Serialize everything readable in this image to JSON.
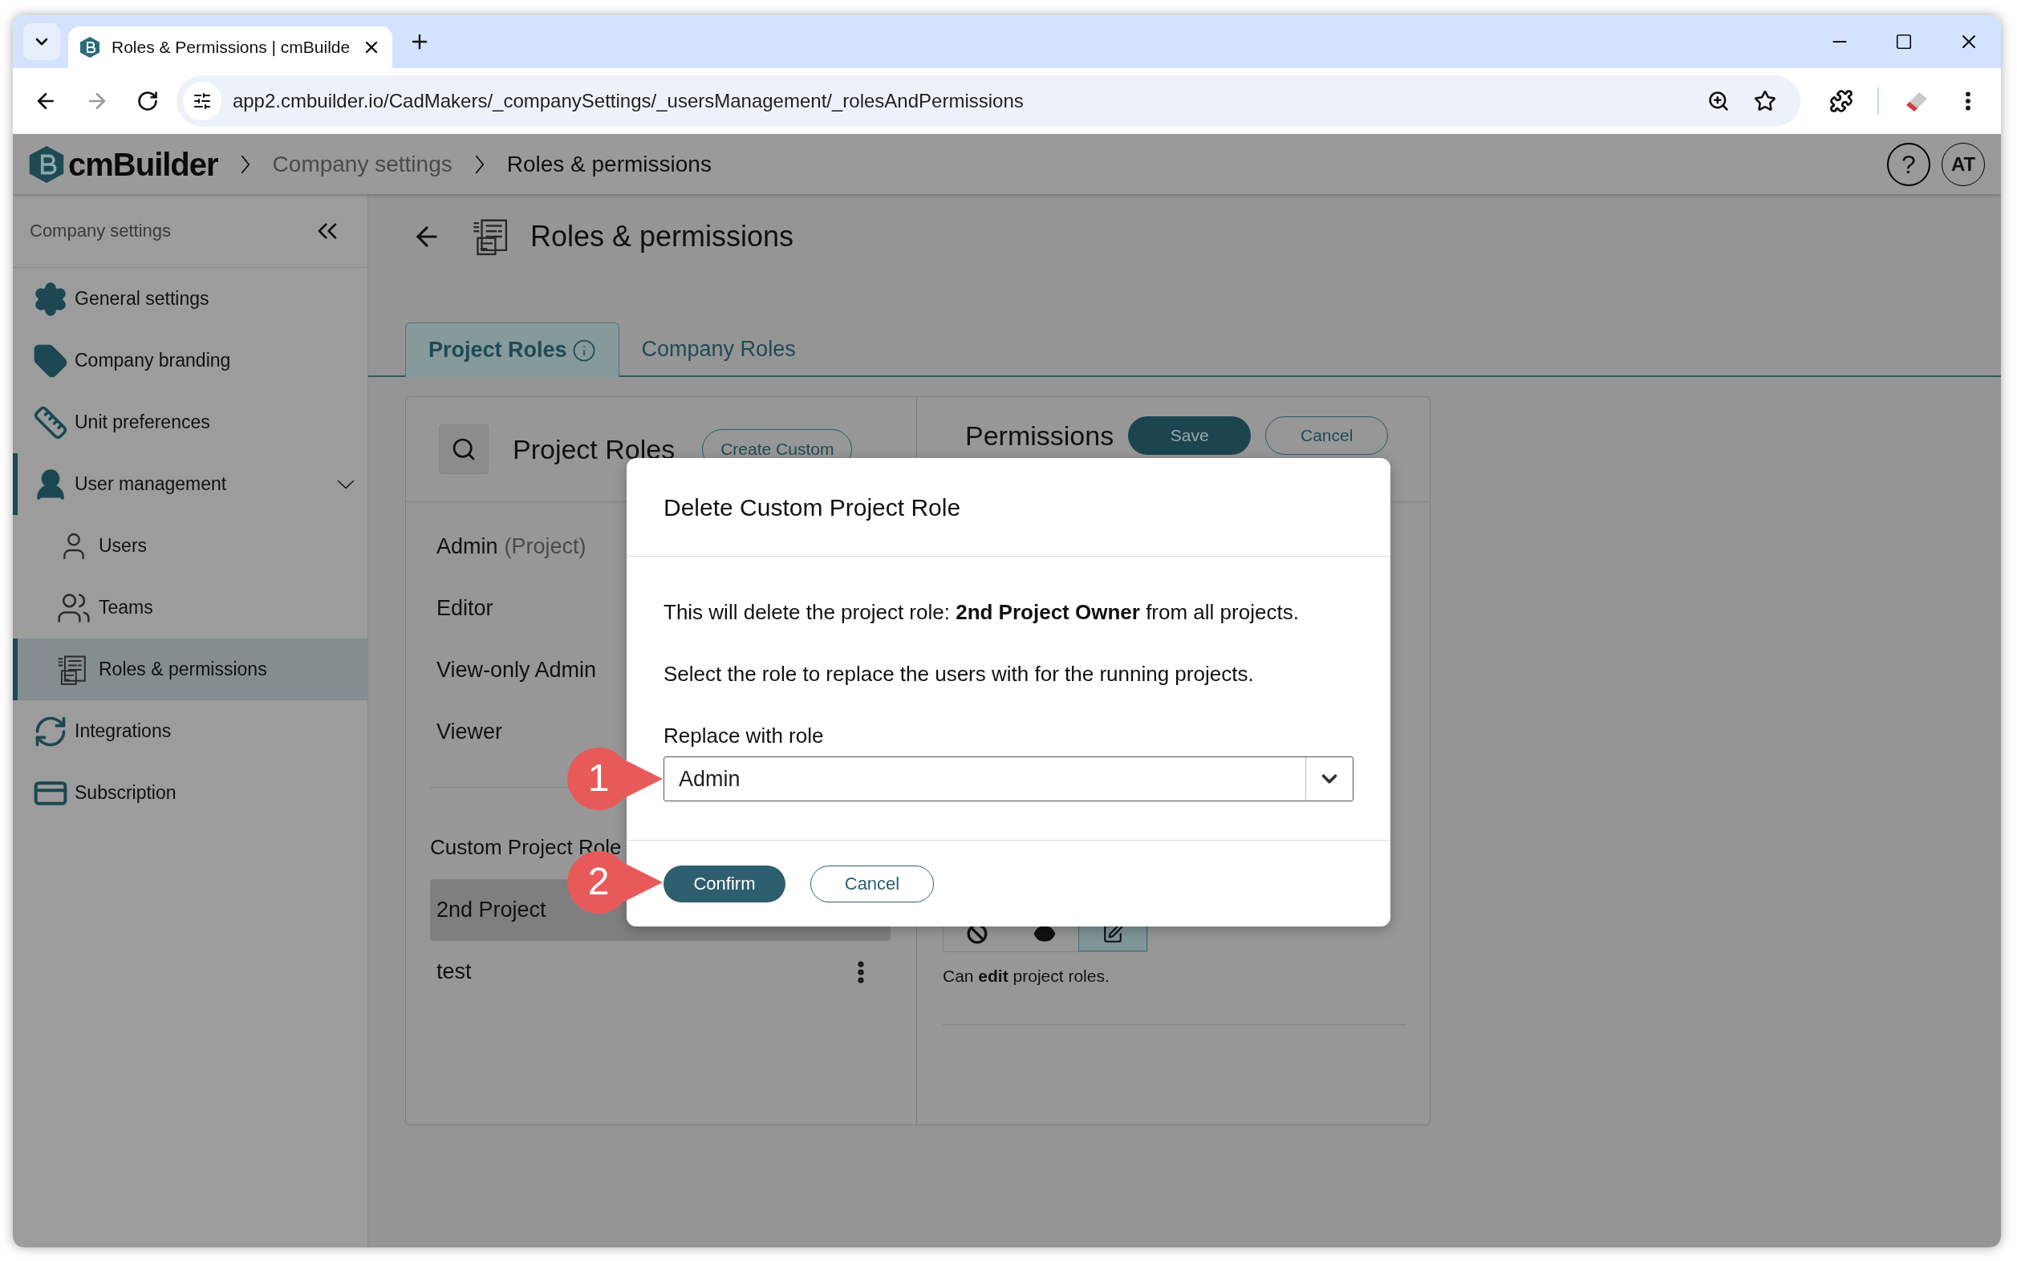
{
  "browser": {
    "tab_title": "Roles & Permissions | cmBuilde",
    "url": "app2.cmbuilder.io/CadMakers/_companySettings/_usersManagement/_rolesAndPermissions"
  },
  "app_header": {
    "logo_text": "cmBuilder",
    "breadcrumbs": [
      "Company settings",
      "Roles & permissions"
    ],
    "help": "?",
    "avatar": "AT"
  },
  "sidebar": {
    "title": "Company settings",
    "items": [
      {
        "label": "General settings",
        "selected": false
      },
      {
        "label": "Company branding",
        "selected": false
      },
      {
        "label": "Unit preferences",
        "selected": false
      },
      {
        "label": "User management",
        "selected": false,
        "expanded": true,
        "children": [
          {
            "label": "Users",
            "selected": false
          },
          {
            "label": "Teams",
            "selected": false
          },
          {
            "label": "Roles & permissions",
            "selected": true
          }
        ]
      },
      {
        "label": "Integrations",
        "selected": false
      },
      {
        "label": "Subscription",
        "selected": false
      }
    ]
  },
  "page": {
    "title": "Roles & permissions",
    "tabs": [
      {
        "label": "Project Roles",
        "selected": true,
        "info": true
      },
      {
        "label": "Company Roles",
        "selected": false,
        "info": false
      }
    ]
  },
  "roles_panel": {
    "title": "Project Roles",
    "create_button": "Create Custom",
    "standard_roles": [
      {
        "name": "Admin",
        "suffix": "(Project)"
      },
      {
        "name": "Editor"
      },
      {
        "name": "View-only Admin"
      },
      {
        "name": "Viewer"
      }
    ],
    "custom_title": "Custom Project Role",
    "custom_roles": [
      {
        "name": "2nd Project",
        "selected": true,
        "menu": false
      },
      {
        "name": "test",
        "selected": false,
        "menu": true
      }
    ]
  },
  "permissions_panel": {
    "title": "Permissions",
    "save": "Save",
    "cancel": "Cancel",
    "access_levels": [
      {
        "kind": "none",
        "selected": false
      },
      {
        "kind": "view",
        "selected": false
      },
      {
        "kind": "edit",
        "selected": true
      }
    ],
    "description": "Can **edit** project roles."
  },
  "dialog": {
    "title": "Delete Custom Project Role",
    "message": "This will delete the project role: **2nd Project Owner** from all projects.",
    "instruction": "Select the role to replace the users with for the running projects.",
    "field_label": "Replace with role",
    "value": "Admin",
    "confirm": "Confirm",
    "cancel": "Cancel"
  },
  "callouts": [
    {
      "number": "1"
    },
    {
      "number": "2"
    }
  ]
}
